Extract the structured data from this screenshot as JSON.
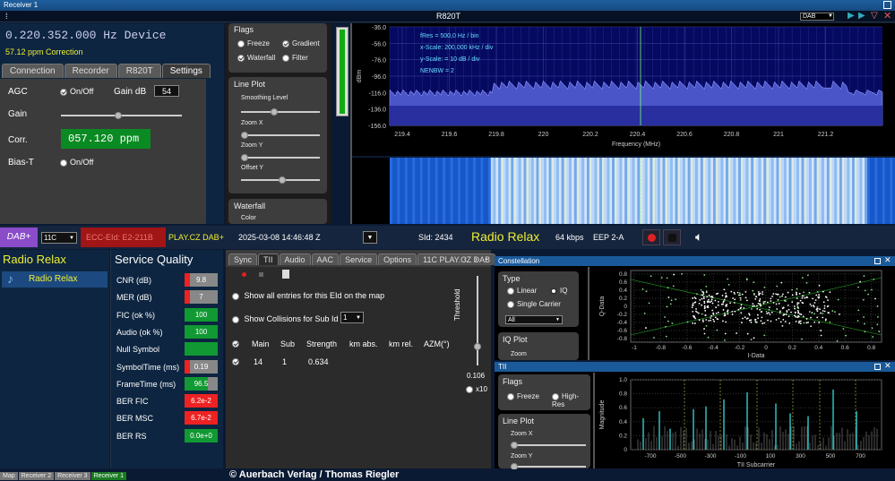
{
  "window": {
    "title": "Receiver 1",
    "toolbar_mode": "DAB",
    "receiver_name": "R820T"
  },
  "left": {
    "frequency": "0.220.352.000 Hz Device",
    "ppm_correction": "57.12 ppm Correction",
    "tabs": [
      "Connection",
      "Recorder",
      "R820T",
      "Settings"
    ],
    "agc_label": "AGC",
    "agc_onoff": "On/Off",
    "gain_db_label": "Gain dB",
    "gain_db_value": "54",
    "gain_label": "Gain",
    "corr_label": "Corr.",
    "corr_value": "057.120 ppm",
    "biast_label": "Bias-T",
    "biast_onoff": "On/Off"
  },
  "flags": {
    "title": "Flags",
    "freeze": "Freeze",
    "gradient": "Gradient",
    "waterfall": "Waterfall",
    "filter": "Filter",
    "lineplot": "Line Plot",
    "smoothing": "Smoothing Level",
    "zoomx": "Zoom X",
    "zoomy": "Zoom Y",
    "offsety": "Offset Y",
    "waterfall_section": "Waterfall",
    "color": "Color"
  },
  "spectrum": {
    "ylabel": "dBm",
    "xlabel": "Frequency (MHz)",
    "yticks": [
      "-36.0",
      "-56.0",
      "-76.0",
      "-96.0",
      "-116.0",
      "-136.0",
      "-156.0"
    ],
    "xticks": [
      "219.4",
      "219.6",
      "219.8",
      "220",
      "220.2",
      "220.4",
      "220.6",
      "220.8",
      "221",
      "221.2"
    ],
    "info": [
      "fRes = 500,0 Hz / bin",
      "x-Scale: 200,000 kHz / div",
      "y-Scale: = 10 dB / div",
      "NENBW = 2"
    ]
  },
  "dabbar": {
    "mode": "DAB+",
    "channel": "11C",
    "ecc": "ECC-EId: E2-211B",
    "ensemble": "PLAY.CZ DAB+",
    "datetime": "2025-03-08  14:46:48 Z",
    "sid": "SId: 2434",
    "service": "Radio Relax",
    "bitrate": "64 kbps",
    "eep": "EEP 2-A"
  },
  "services": {
    "title": "Radio Relax",
    "items": [
      "Radio Relax"
    ]
  },
  "quality": {
    "title": "Service Quality",
    "rows": [
      {
        "label": "CNR (dB)",
        "value": "9.8",
        "color": "#888888",
        "fill": 0.1
      },
      {
        "label": "MER (dB)",
        "value": "7",
        "color": "#888888",
        "fill": 0.15
      },
      {
        "label": "FIC (ok %)",
        "value": "100",
        "color": "#119933",
        "fill": 1
      },
      {
        "label": "Audio (ok %)",
        "value": "100",
        "color": "#119933",
        "fill": 1
      },
      {
        "label": "Null Symbol",
        "value": "",
        "color": "#119933",
        "fill": 1
      },
      {
        "label": "SymbolTime (ms)",
        "value": "0.19",
        "color": "#888888",
        "fill": 0.1
      },
      {
        "label": "FrameTime (ms)",
        "value": "96.5",
        "color": "#119933",
        "fill": 0.7
      },
      {
        "label": "BER FIC",
        "value": "6.2e-2",
        "color": "#ee2222",
        "fill": 1
      },
      {
        "label": "BER MSC",
        "value": "6.7e-2",
        "color": "#ee2222",
        "fill": 1
      },
      {
        "label": "BER RS",
        "value": "0.0e+0",
        "color": "#119933",
        "fill": 1
      }
    ]
  },
  "tii": {
    "tabs": [
      "Sync",
      "TII",
      "Audio",
      "AAC",
      "Service",
      "Options",
      "11C PLAY.CZ DAB"
    ],
    "show_all": "Show all entries for this EId on the map",
    "show_collisions": "Show Collisions for Sub Id",
    "sub_select": "1",
    "threshold": "Threshold",
    "threshold_val": "0.106",
    "x10": "x10",
    "headers": [
      "Main",
      "Sub",
      "Strength",
      "km abs.",
      "km rel.",
      "AZM(°)"
    ],
    "rows": [
      [
        "14",
        "1",
        "0.634",
        "",
        "",
        ""
      ]
    ]
  },
  "constellation": {
    "title": "Constellation",
    "type": "Type",
    "linear": "Linear",
    "iq": "IQ",
    "single": "Single Carrier",
    "select": "All",
    "iqplot": "IQ Plot",
    "zoom": "Zoom",
    "ylabel": "Q-Data",
    "xlabel": "I-Data",
    "xticks": [
      "-1",
      "-0.8",
      "-0.6",
      "-0.4",
      "-0.2",
      "0",
      "0.2",
      "0.4",
      "0.6",
      "0.8"
    ],
    "yticks": [
      "0.8",
      "0.6",
      "0.4",
      "0.2",
      "0",
      "-0.2",
      "-0.4",
      "-0.6",
      "-0.8"
    ]
  },
  "tiipanel": {
    "title": "TII",
    "flags": "Flags",
    "freeze": "Freeze",
    "highres": "High-Res",
    "lineplot": "Line Plot",
    "zoomx": "Zoom X",
    "zoomy": "Zoom Y",
    "ylabel": "Magnitude",
    "xlabel": "TII Subcarrier",
    "xticks": [
      "-700",
      "-500",
      "-300",
      "-100",
      "100",
      "300",
      "500",
      "700"
    ],
    "yticks": [
      "1.0",
      "0.8",
      "0.6",
      "0.4",
      "0.2",
      "0"
    ]
  },
  "bottom": {
    "tabs": [
      "Map",
      "Receiver 2",
      "Receiver 3",
      "Receiver 1"
    ],
    "copyright": "© Auerbach Verlag / Thomas Riegler"
  }
}
